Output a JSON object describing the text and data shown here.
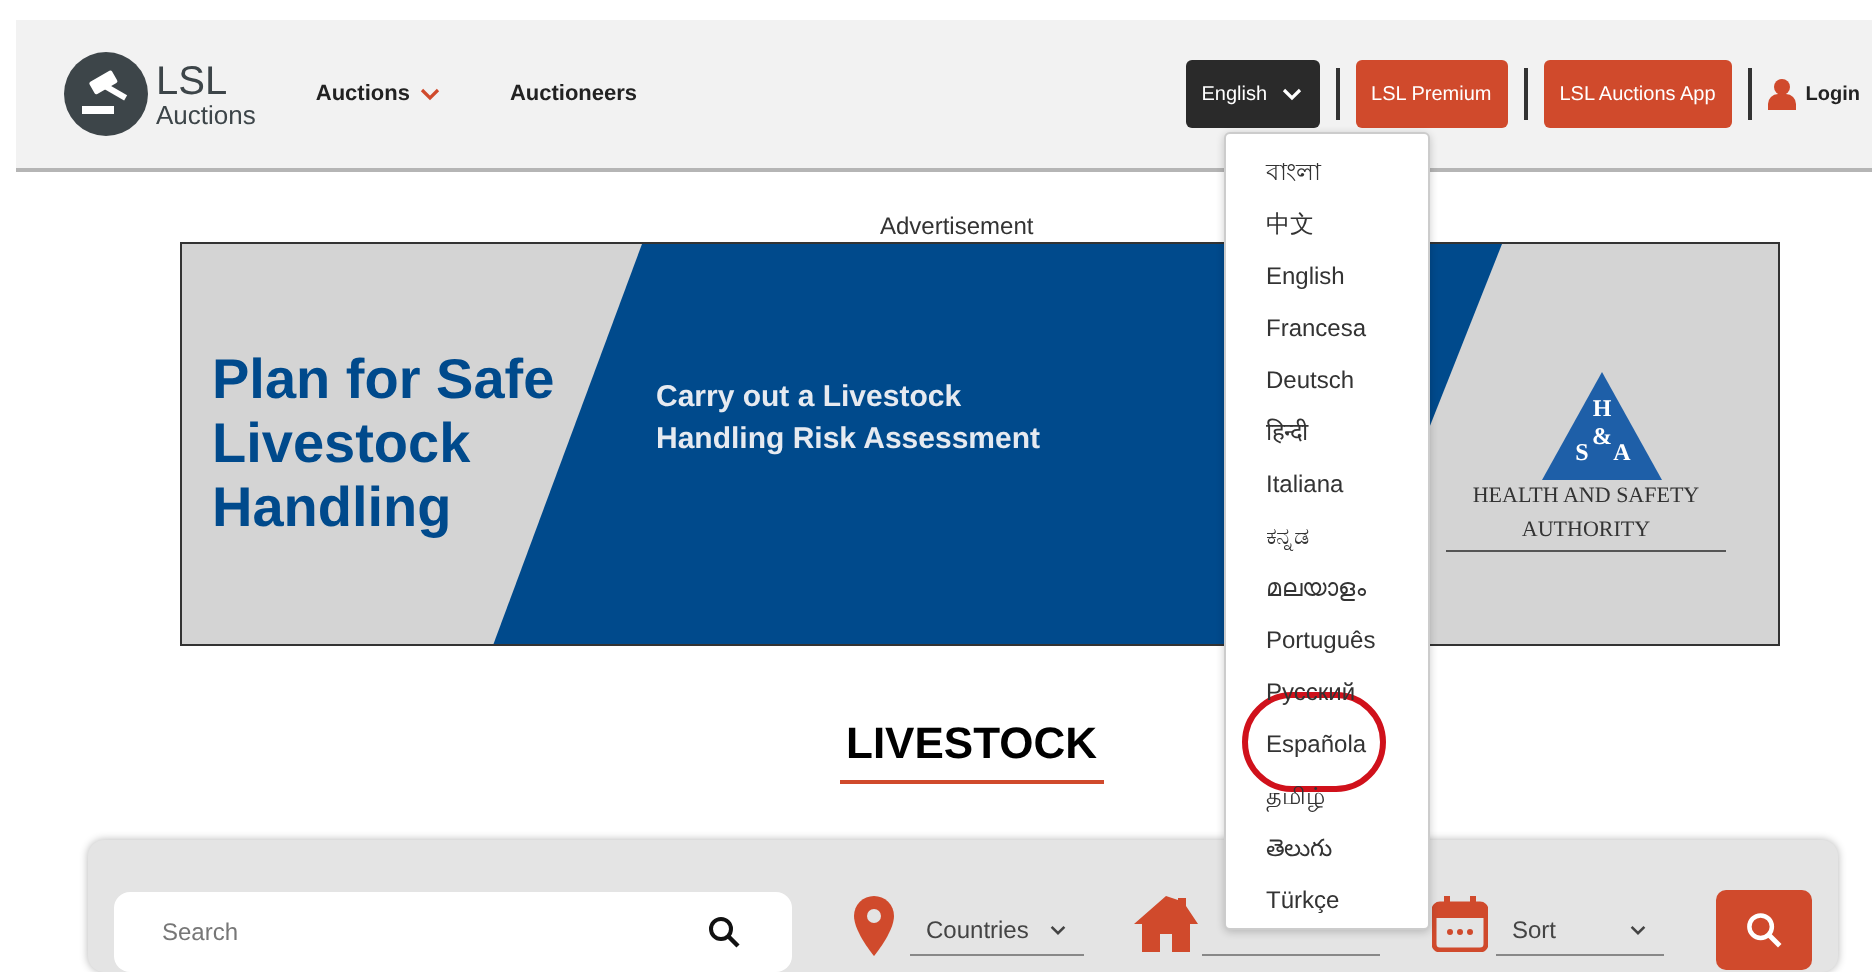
{
  "header": {
    "logo": {
      "title": "LSL",
      "subtitle": "Auctions"
    },
    "nav": [
      {
        "label": "Auctions",
        "has_menu": true
      },
      {
        "label": "Auctioneers",
        "has_menu": false
      }
    ],
    "language_button": "English",
    "buttons": [
      "LSL Premium",
      "LSL Auctions App"
    ],
    "login": "Login"
  },
  "language_menu": {
    "items": [
      {
        "label": "বাংলা",
        "circled": false
      },
      {
        "label": "中文",
        "circled": false
      },
      {
        "label": "English",
        "circled": false
      },
      {
        "label": "Francesa",
        "circled": false
      },
      {
        "label": "Deutsch",
        "circled": false
      },
      {
        "label": "हिन्दी",
        "circled": false
      },
      {
        "label": "Italiana",
        "circled": false
      },
      {
        "label": "ಕನ್ನಡ",
        "circled": false
      },
      {
        "label": "മലയാളം",
        "circled": false
      },
      {
        "label": "Português",
        "circled": false
      },
      {
        "label": "Русский",
        "circled": false
      },
      {
        "label": "Española",
        "circled": true
      },
      {
        "label": "தமிழ்",
        "circled": false
      },
      {
        "label": "తెలుగు",
        "circled": false
      },
      {
        "label": "Türkçe",
        "circled": false
      }
    ]
  },
  "advertisement": {
    "label": "Advertisement",
    "headline": "Plan for Safe Livestock Handling",
    "subline": "Carry out a Livestock Handling Risk Assessment",
    "logo_letters": [
      "H",
      "S",
      "&",
      "A"
    ],
    "authority": "HEALTH AND SAFETY AUTHORITY"
  },
  "section_title": "LIVESTOCK",
  "filters": {
    "search": {
      "placeholder": "Search"
    },
    "selects": [
      {
        "kind": "location",
        "value": "Countries"
      },
      {
        "kind": "home"
      },
      {
        "kind": "calendar",
        "value": "Sort"
      }
    ]
  }
}
